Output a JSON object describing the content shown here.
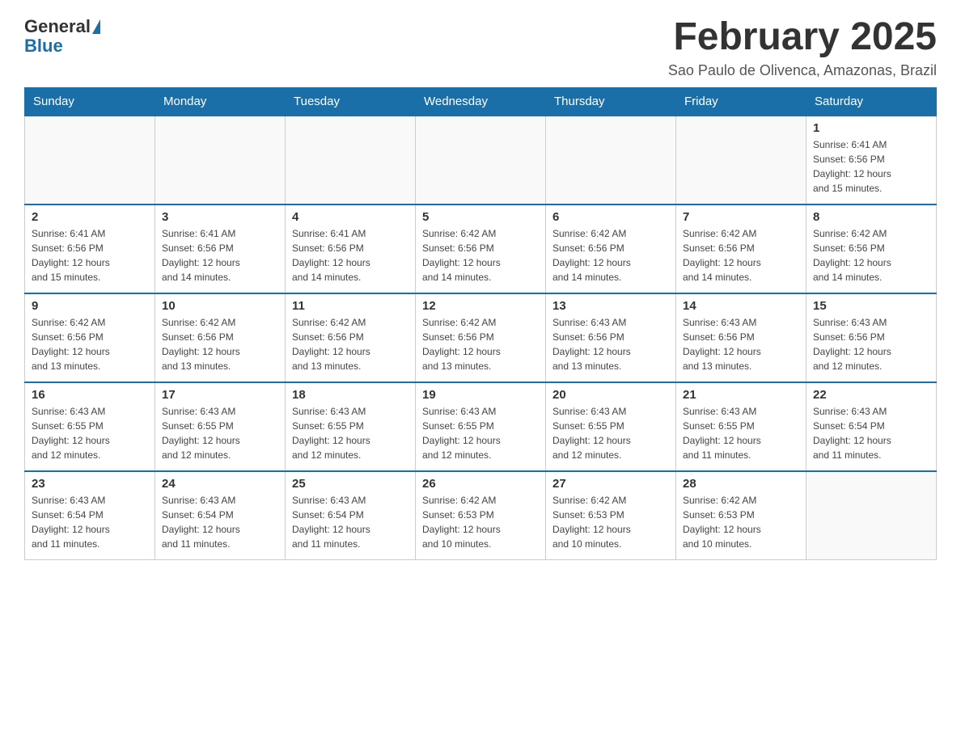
{
  "logo": {
    "general": "General",
    "blue": "Blue"
  },
  "header": {
    "month_title": "February 2025",
    "location": "Sao Paulo de Olivenca, Amazonas, Brazil"
  },
  "days_of_week": [
    "Sunday",
    "Monday",
    "Tuesday",
    "Wednesday",
    "Thursday",
    "Friday",
    "Saturday"
  ],
  "weeks": [
    [
      {
        "day": "",
        "info": ""
      },
      {
        "day": "",
        "info": ""
      },
      {
        "day": "",
        "info": ""
      },
      {
        "day": "",
        "info": ""
      },
      {
        "day": "",
        "info": ""
      },
      {
        "day": "",
        "info": ""
      },
      {
        "day": "1",
        "info": "Sunrise: 6:41 AM\nSunset: 6:56 PM\nDaylight: 12 hours\nand 15 minutes."
      }
    ],
    [
      {
        "day": "2",
        "info": "Sunrise: 6:41 AM\nSunset: 6:56 PM\nDaylight: 12 hours\nand 15 minutes."
      },
      {
        "day": "3",
        "info": "Sunrise: 6:41 AM\nSunset: 6:56 PM\nDaylight: 12 hours\nand 14 minutes."
      },
      {
        "day": "4",
        "info": "Sunrise: 6:41 AM\nSunset: 6:56 PM\nDaylight: 12 hours\nand 14 minutes."
      },
      {
        "day": "5",
        "info": "Sunrise: 6:42 AM\nSunset: 6:56 PM\nDaylight: 12 hours\nand 14 minutes."
      },
      {
        "day": "6",
        "info": "Sunrise: 6:42 AM\nSunset: 6:56 PM\nDaylight: 12 hours\nand 14 minutes."
      },
      {
        "day": "7",
        "info": "Sunrise: 6:42 AM\nSunset: 6:56 PM\nDaylight: 12 hours\nand 14 minutes."
      },
      {
        "day": "8",
        "info": "Sunrise: 6:42 AM\nSunset: 6:56 PM\nDaylight: 12 hours\nand 14 minutes."
      }
    ],
    [
      {
        "day": "9",
        "info": "Sunrise: 6:42 AM\nSunset: 6:56 PM\nDaylight: 12 hours\nand 13 minutes."
      },
      {
        "day": "10",
        "info": "Sunrise: 6:42 AM\nSunset: 6:56 PM\nDaylight: 12 hours\nand 13 minutes."
      },
      {
        "day": "11",
        "info": "Sunrise: 6:42 AM\nSunset: 6:56 PM\nDaylight: 12 hours\nand 13 minutes."
      },
      {
        "day": "12",
        "info": "Sunrise: 6:42 AM\nSunset: 6:56 PM\nDaylight: 12 hours\nand 13 minutes."
      },
      {
        "day": "13",
        "info": "Sunrise: 6:43 AM\nSunset: 6:56 PM\nDaylight: 12 hours\nand 13 minutes."
      },
      {
        "day": "14",
        "info": "Sunrise: 6:43 AM\nSunset: 6:56 PM\nDaylight: 12 hours\nand 13 minutes."
      },
      {
        "day": "15",
        "info": "Sunrise: 6:43 AM\nSunset: 6:56 PM\nDaylight: 12 hours\nand 12 minutes."
      }
    ],
    [
      {
        "day": "16",
        "info": "Sunrise: 6:43 AM\nSunset: 6:55 PM\nDaylight: 12 hours\nand 12 minutes."
      },
      {
        "day": "17",
        "info": "Sunrise: 6:43 AM\nSunset: 6:55 PM\nDaylight: 12 hours\nand 12 minutes."
      },
      {
        "day": "18",
        "info": "Sunrise: 6:43 AM\nSunset: 6:55 PM\nDaylight: 12 hours\nand 12 minutes."
      },
      {
        "day": "19",
        "info": "Sunrise: 6:43 AM\nSunset: 6:55 PM\nDaylight: 12 hours\nand 12 minutes."
      },
      {
        "day": "20",
        "info": "Sunrise: 6:43 AM\nSunset: 6:55 PM\nDaylight: 12 hours\nand 12 minutes."
      },
      {
        "day": "21",
        "info": "Sunrise: 6:43 AM\nSunset: 6:55 PM\nDaylight: 12 hours\nand 11 minutes."
      },
      {
        "day": "22",
        "info": "Sunrise: 6:43 AM\nSunset: 6:54 PM\nDaylight: 12 hours\nand 11 minutes."
      }
    ],
    [
      {
        "day": "23",
        "info": "Sunrise: 6:43 AM\nSunset: 6:54 PM\nDaylight: 12 hours\nand 11 minutes."
      },
      {
        "day": "24",
        "info": "Sunrise: 6:43 AM\nSunset: 6:54 PM\nDaylight: 12 hours\nand 11 minutes."
      },
      {
        "day": "25",
        "info": "Sunrise: 6:43 AM\nSunset: 6:54 PM\nDaylight: 12 hours\nand 11 minutes."
      },
      {
        "day": "26",
        "info": "Sunrise: 6:42 AM\nSunset: 6:53 PM\nDaylight: 12 hours\nand 10 minutes."
      },
      {
        "day": "27",
        "info": "Sunrise: 6:42 AM\nSunset: 6:53 PM\nDaylight: 12 hours\nand 10 minutes."
      },
      {
        "day": "28",
        "info": "Sunrise: 6:42 AM\nSunset: 6:53 PM\nDaylight: 12 hours\nand 10 minutes."
      },
      {
        "day": "",
        "info": ""
      }
    ]
  ]
}
